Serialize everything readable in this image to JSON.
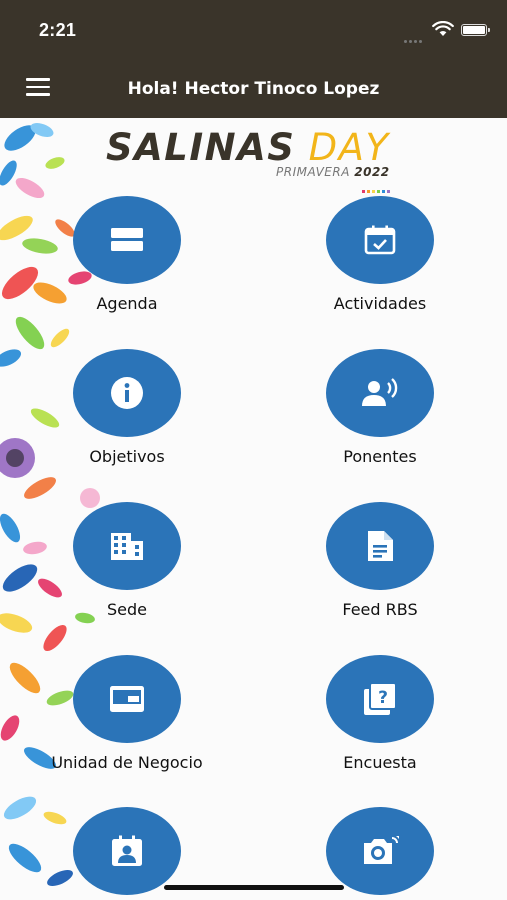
{
  "status_bar": {
    "time": "2:21"
  },
  "header": {
    "greeting": "Hola! Hector Tinoco Lopez"
  },
  "logo": {
    "salinas": "SALINAS",
    "day": "DAY",
    "subtitle": "PRIMAVERA",
    "year": "2022"
  },
  "colors": {
    "header_bg": "#3a342a",
    "accent": "#2b74b8",
    "logo_day": "#f2b51a",
    "background": "#fbfbfb"
  },
  "menu": [
    {
      "label": "Agenda",
      "icon": "agenda-icon"
    },
    {
      "label": "Actividades",
      "icon": "calendar-check-icon"
    },
    {
      "label": "Objetivos",
      "icon": "info-icon"
    },
    {
      "label": "Ponentes",
      "icon": "speaker-icon"
    },
    {
      "label": "Sede",
      "icon": "building-icon"
    },
    {
      "label": "Feed RBS",
      "icon": "document-icon"
    },
    {
      "label": "Unidad de Negocio",
      "icon": "card-icon"
    },
    {
      "label": "Encuesta",
      "icon": "survey-icon"
    },
    {
      "label": "",
      "icon": "contact-badge-icon"
    },
    {
      "label": "",
      "icon": "camera-icon"
    }
  ]
}
